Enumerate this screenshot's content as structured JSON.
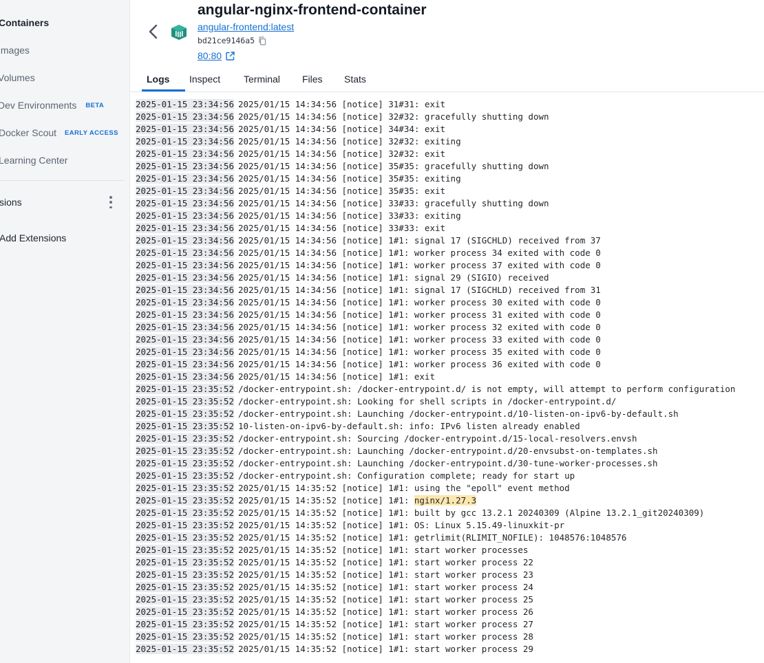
{
  "sidebar": {
    "items": [
      {
        "label": "Containers",
        "active": true
      },
      {
        "label": "Images"
      },
      {
        "label": "Volumes"
      },
      {
        "label": "Dev Environments",
        "badge": "BETA"
      },
      {
        "label": "Docker Scout",
        "badge": "EARLY ACCESS"
      },
      {
        "label": "Learning Center"
      }
    ],
    "extensions_label": "sions",
    "add_extensions_label": "Add Extensions"
  },
  "header": {
    "title": "angular-nginx-frontend-container",
    "image_link": "angular-frontend:latest",
    "container_id": "bd21ce9146a5",
    "port_link": "80:80",
    "icons": [
      "chevron-left-icon",
      "container-cube-icon",
      "copy-icon",
      "external-link-icon"
    ]
  },
  "tabs": [
    {
      "label": "Logs",
      "active": true
    },
    {
      "label": "Inspect"
    },
    {
      "label": "Terminal"
    },
    {
      "label": "Files"
    },
    {
      "label": "Stats"
    }
  ],
  "colors": {
    "accent": "#1570d4",
    "timestamp_bg": "#e8eaed",
    "highlight_bg": "#fde7ae",
    "sidebar_bg": "#f4f5f7"
  },
  "logs": [
    {
      "ts": "2025-01-15 23:34:56",
      "msg": "2025/01/15 14:34:56 [notice] 31#31: exit"
    },
    {
      "ts": "2025-01-15 23:34:56",
      "msg": "2025/01/15 14:34:56 [notice] 32#32: gracefully shutting down"
    },
    {
      "ts": "2025-01-15 23:34:56",
      "msg": "2025/01/15 14:34:56 [notice] 34#34: exit"
    },
    {
      "ts": "2025-01-15 23:34:56",
      "msg": "2025/01/15 14:34:56 [notice] 32#32: exiting"
    },
    {
      "ts": "2025-01-15 23:34:56",
      "msg": "2025/01/15 14:34:56 [notice] 32#32: exit"
    },
    {
      "ts": "2025-01-15 23:34:56",
      "msg": "2025/01/15 14:34:56 [notice] 35#35: gracefully shutting down"
    },
    {
      "ts": "2025-01-15 23:34:56",
      "msg": "2025/01/15 14:34:56 [notice] 35#35: exiting"
    },
    {
      "ts": "2025-01-15 23:34:56",
      "msg": "2025/01/15 14:34:56 [notice] 35#35: exit"
    },
    {
      "ts": "2025-01-15 23:34:56",
      "msg": "2025/01/15 14:34:56 [notice] 33#33: gracefully shutting down"
    },
    {
      "ts": "2025-01-15 23:34:56",
      "msg": "2025/01/15 14:34:56 [notice] 33#33: exiting"
    },
    {
      "ts": "2025-01-15 23:34:56",
      "msg": "2025/01/15 14:34:56 [notice] 33#33: exit"
    },
    {
      "ts": "2025-01-15 23:34:56",
      "msg": "2025/01/15 14:34:56 [notice] 1#1: signal 17 (SIGCHLD) received from 37"
    },
    {
      "ts": "2025-01-15 23:34:56",
      "msg": "2025/01/15 14:34:56 [notice] 1#1: worker process 34 exited with code 0"
    },
    {
      "ts": "2025-01-15 23:34:56",
      "msg": "2025/01/15 14:34:56 [notice] 1#1: worker process 37 exited with code 0"
    },
    {
      "ts": "2025-01-15 23:34:56",
      "msg": "2025/01/15 14:34:56 [notice] 1#1: signal 29 (SIGIO) received"
    },
    {
      "ts": "2025-01-15 23:34:56",
      "msg": "2025/01/15 14:34:56 [notice] 1#1: signal 17 (SIGCHLD) received from 31"
    },
    {
      "ts": "2025-01-15 23:34:56",
      "msg": "2025/01/15 14:34:56 [notice] 1#1: worker process 30 exited with code 0"
    },
    {
      "ts": "2025-01-15 23:34:56",
      "msg": "2025/01/15 14:34:56 [notice] 1#1: worker process 31 exited with code 0"
    },
    {
      "ts": "2025-01-15 23:34:56",
      "msg": "2025/01/15 14:34:56 [notice] 1#1: worker process 32 exited with code 0"
    },
    {
      "ts": "2025-01-15 23:34:56",
      "msg": "2025/01/15 14:34:56 [notice] 1#1: worker process 33 exited with code 0"
    },
    {
      "ts": "2025-01-15 23:34:56",
      "msg": "2025/01/15 14:34:56 [notice] 1#1: worker process 35 exited with code 0"
    },
    {
      "ts": "2025-01-15 23:34:56",
      "msg": "2025/01/15 14:34:56 [notice] 1#1: worker process 36 exited with code 0"
    },
    {
      "ts": "2025-01-15 23:34:56",
      "msg": "2025/01/15 14:34:56 [notice] 1#1: exit"
    },
    {
      "ts": "2025-01-15 23:35:52",
      "msg": "/docker-entrypoint.sh: /docker-entrypoint.d/ is not empty, will attempt to perform configuration"
    },
    {
      "ts": "2025-01-15 23:35:52",
      "msg": "/docker-entrypoint.sh: Looking for shell scripts in /docker-entrypoint.d/"
    },
    {
      "ts": "2025-01-15 23:35:52",
      "msg": "/docker-entrypoint.sh: Launching /docker-entrypoint.d/10-listen-on-ipv6-by-default.sh"
    },
    {
      "ts": "2025-01-15 23:35:52",
      "msg": "10-listen-on-ipv6-by-default.sh: info: IPv6 listen already enabled"
    },
    {
      "ts": "2025-01-15 23:35:52",
      "msg": "/docker-entrypoint.sh: Sourcing /docker-entrypoint.d/15-local-resolvers.envsh"
    },
    {
      "ts": "2025-01-15 23:35:52",
      "msg": "/docker-entrypoint.sh: Launching /docker-entrypoint.d/20-envsubst-on-templates.sh"
    },
    {
      "ts": "2025-01-15 23:35:52",
      "msg": "/docker-entrypoint.sh: Launching /docker-entrypoint.d/30-tune-worker-processes.sh"
    },
    {
      "ts": "2025-01-15 23:35:52",
      "msg": "/docker-entrypoint.sh: Configuration complete; ready for start up"
    },
    {
      "ts": "2025-01-15 23:35:52",
      "msg": "2025/01/15 14:35:52 [notice] 1#1: using the \"epoll\" event method"
    },
    {
      "ts": "2025-01-15 23:35:52",
      "msg": "2025/01/15 14:35:52 [notice] 1#1: ",
      "highlight": "nginx/1.27.3"
    },
    {
      "ts": "2025-01-15 23:35:52",
      "msg": "2025/01/15 14:35:52 [notice] 1#1: built by gcc 13.2.1 20240309 (Alpine 13.2.1_git20240309)"
    },
    {
      "ts": "2025-01-15 23:35:52",
      "msg": "2025/01/15 14:35:52 [notice] 1#1: OS: Linux 5.15.49-linuxkit-pr"
    },
    {
      "ts": "2025-01-15 23:35:52",
      "msg": "2025/01/15 14:35:52 [notice] 1#1: getrlimit(RLIMIT_NOFILE): 1048576:1048576"
    },
    {
      "ts": "2025-01-15 23:35:52",
      "msg": "2025/01/15 14:35:52 [notice] 1#1: start worker processes"
    },
    {
      "ts": "2025-01-15 23:35:52",
      "msg": "2025/01/15 14:35:52 [notice] 1#1: start worker process 22"
    },
    {
      "ts": "2025-01-15 23:35:52",
      "msg": "2025/01/15 14:35:52 [notice] 1#1: start worker process 23"
    },
    {
      "ts": "2025-01-15 23:35:52",
      "msg": "2025/01/15 14:35:52 [notice] 1#1: start worker process 24"
    },
    {
      "ts": "2025-01-15 23:35:52",
      "msg": "2025/01/15 14:35:52 [notice] 1#1: start worker process 25"
    },
    {
      "ts": "2025-01-15 23:35:52",
      "msg": "2025/01/15 14:35:52 [notice] 1#1: start worker process 26"
    },
    {
      "ts": "2025-01-15 23:35:52",
      "msg": "2025/01/15 14:35:52 [notice] 1#1: start worker process 27"
    },
    {
      "ts": "2025-01-15 23:35:52",
      "msg": "2025/01/15 14:35:52 [notice] 1#1: start worker process 28"
    },
    {
      "ts": "2025-01-15 23:35:52",
      "msg": "2025/01/15 14:35:52 [notice] 1#1: start worker process 29"
    }
  ]
}
